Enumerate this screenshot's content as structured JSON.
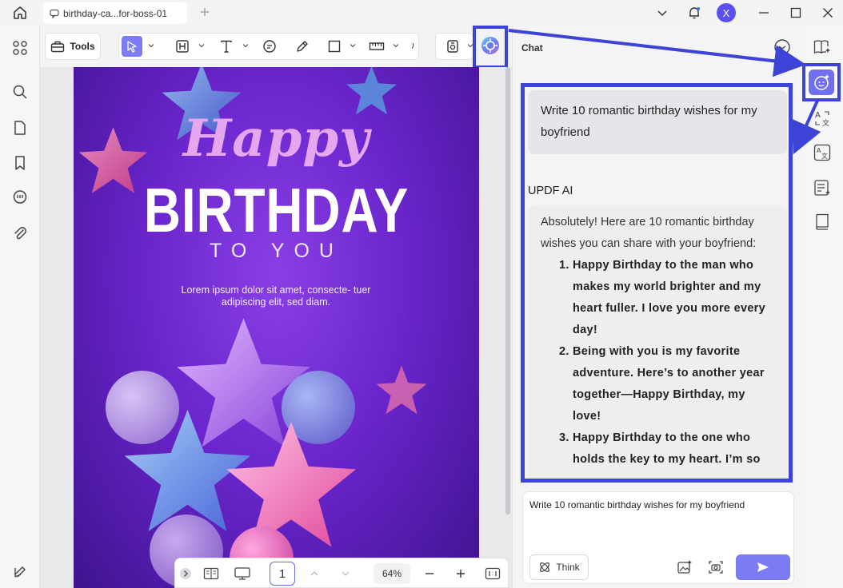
{
  "window": {
    "tab_title": "birthday-ca...for-boss-01",
    "avatar_initial": "X"
  },
  "toolbar": {
    "tools_label": "Tools"
  },
  "document": {
    "happy": "Happy",
    "birthday": "BIRTHDAY",
    "to_you": "TO YOU",
    "lorem": "Lorem ipsum dolor sit amet, consecte- tuer adipiscing elit, sed diam."
  },
  "bottom_nav": {
    "page_number": "1",
    "zoom": "64%"
  },
  "chat": {
    "title": "Chat",
    "user_message": "Write 10 romantic birthday wishes for my boyfriend",
    "ai_name": "UPDF AI",
    "ai_intro": "Absolutely! Here are 10 romantic birthday wishes you can share with your boyfriend:",
    "ai_items": [
      "Happy Birthday to the man who makes my world brighter and my heart fuller. I love you more every day!",
      "Being with you is my favorite adventure. Here’s to another year together—Happy Birthday, my love!",
      "Happy Birthday to the one who holds the key to my heart. I’m so"
    ],
    "input_value": "Write 10 romantic birthday wishes for my boyfriend",
    "think_label": "Think"
  },
  "colors": {
    "accent": "#3d43d6",
    "active_tool": "#7d7bf6",
    "send_button": "#7b7bf2",
    "avatar": "#5a4ff0"
  }
}
